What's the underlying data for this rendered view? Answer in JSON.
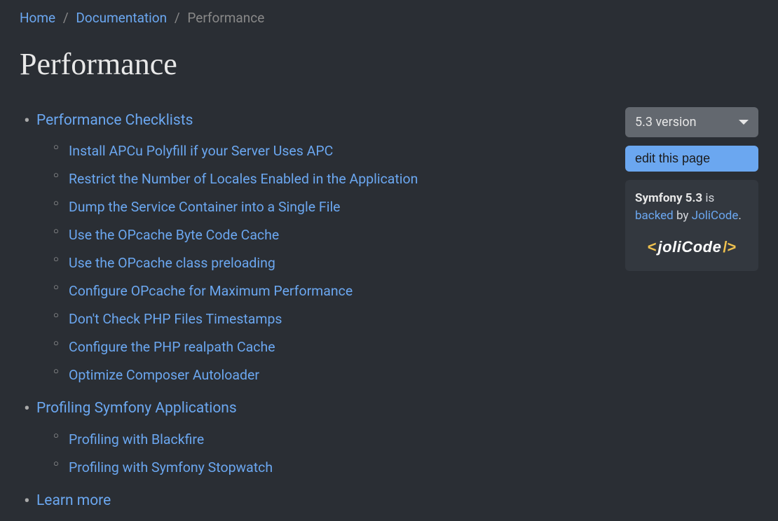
{
  "breadcrumb": {
    "home": "Home",
    "docs": "Documentation",
    "current": "Performance"
  },
  "title": "Performance",
  "toc": {
    "s0": {
      "label": "Performance Checklists",
      "items": {
        "i0": "Install APCu Polyfill if your Server Uses APC",
        "i1": "Restrict the Number of Locales Enabled in the Application",
        "i2": "Dump the Service Container into a Single File",
        "i3": "Use the OPcache Byte Code Cache",
        "i4": "Use the OPcache class preloading",
        "i5": "Configure OPcache for Maximum Performance",
        "i6": "Don't Check PHP Files Timestamps",
        "i7": "Configure the PHP realpath Cache",
        "i8": "Optimize Composer Autoloader"
      }
    },
    "s1": {
      "label": "Profiling Symfony Applications",
      "items": {
        "i0": "Profiling with Blackfire",
        "i1": "Profiling with Symfony Stopwatch"
      }
    },
    "s2": {
      "label": "Learn more"
    }
  },
  "sidebar": {
    "version_label": "5.3 version",
    "edit_label": "edit this page",
    "backed": {
      "product": "Symfony 5.3",
      "is_text": " is ",
      "backed_link": "backed",
      "by_text": " by ",
      "sponsor_link": "JoliCode",
      "period": ".",
      "logo_bracket_open": "<",
      "logo_text": "joliCode",
      "logo_bracket_close": "/>"
    }
  }
}
